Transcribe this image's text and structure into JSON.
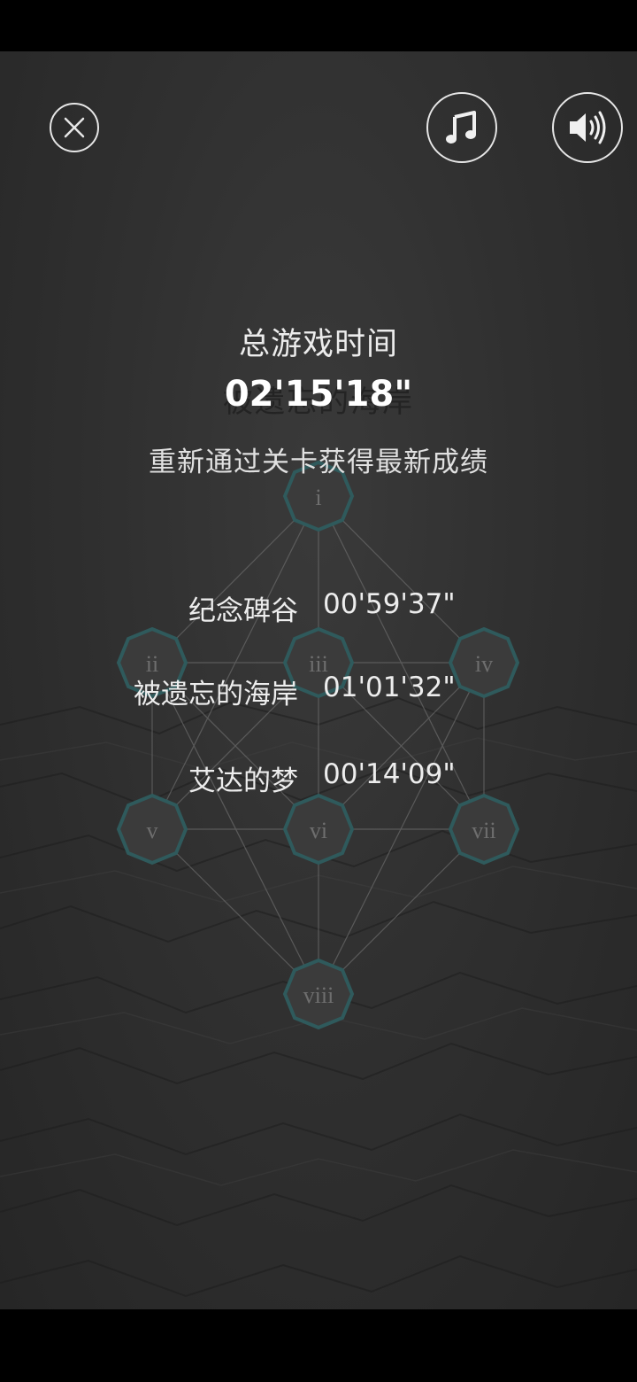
{
  "overlay": {
    "title": "总游戏时间",
    "total_time": "02'15'18\"",
    "hint": "重新通过关卡获得最新成绩"
  },
  "background_label": "被遗忘的海岸",
  "scores": [
    {
      "name": "纪念碑谷",
      "time": "00'59'37\""
    },
    {
      "name": "被遗忘的海岸",
      "time": "01'01'32\""
    },
    {
      "name": "艾达的梦",
      "time": "00'14'09\""
    }
  ],
  "chapters": [
    "i",
    "ii",
    "iii",
    "iv",
    "v",
    "vi",
    "vii",
    "viii"
  ],
  "icons": {
    "close": "close-icon",
    "music": "music-note-icon",
    "sound": "speaker-volume-icon"
  },
  "colors": {
    "node_fill": "#3b3b3b",
    "node_stroke": "#2f5a5c",
    "line": "#6b6b6b",
    "text": "#e8e8e8"
  }
}
